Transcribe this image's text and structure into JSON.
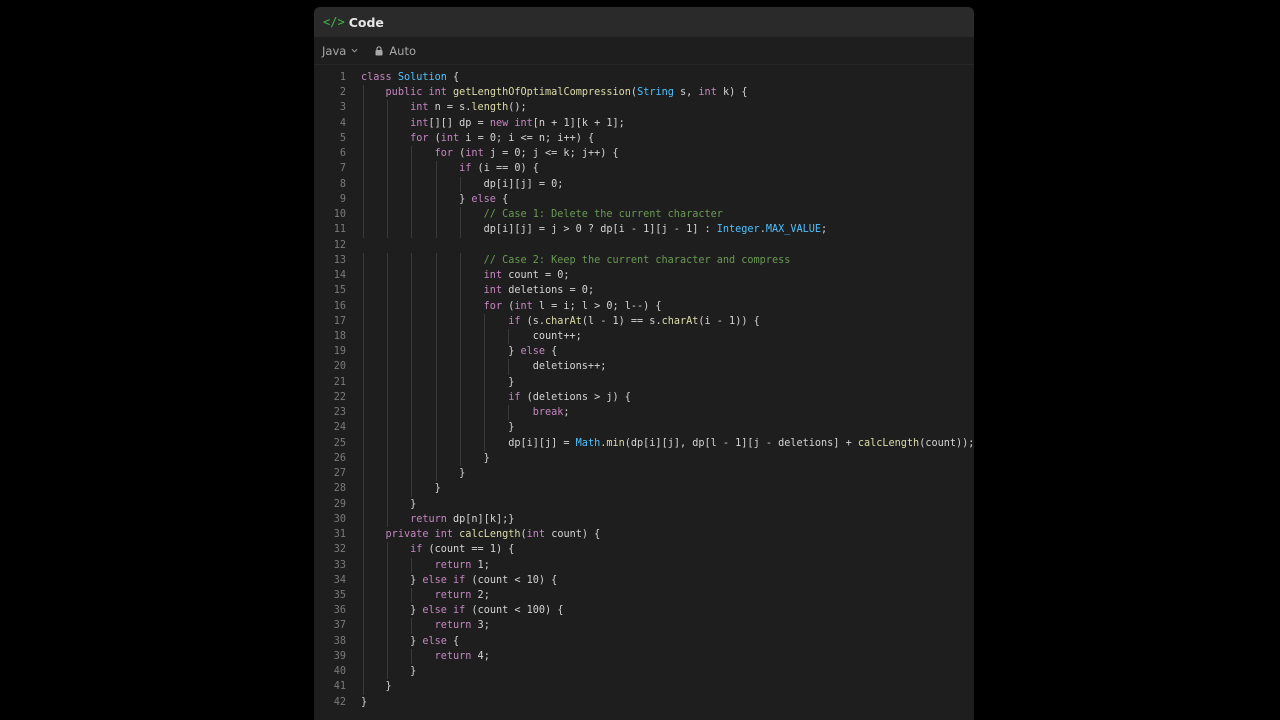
{
  "header": {
    "title": "Code",
    "icon": "code-icon"
  },
  "toolbar": {
    "language": "Java",
    "mode": "Auto"
  },
  "colors": {
    "background": "#000000",
    "panel": "#1e1e1e",
    "header": "#2a2a2a",
    "keyword": "#c586c0",
    "type": "#4fc1ff",
    "function": "#dcdcaa",
    "comment": "#6a9955",
    "text": "#d4d4d4",
    "line_number": "#7a7a7a",
    "code_icon": "#3fb950"
  },
  "code": {
    "language": "java",
    "lines": [
      "class Solution {",
      "    public int getLengthOfOptimalCompression(String s, int k) {",
      "        int n = s.length();",
      "        int[][] dp = new int[n + 1][k + 1];",
      "        for (int i = 0; i <= n; i++) {",
      "            for (int j = 0; j <= k; j++) {",
      "                if (i == 0) {",
      "                    dp[i][j] = 0;",
      "                } else {",
      "                    // Case 1: Delete the current character",
      "                    dp[i][j] = j > 0 ? dp[i - 1][j - 1] : Integer.MAX_VALUE;",
      "",
      "                    // Case 2: Keep the current character and compress",
      "                    int count = 0;",
      "                    int deletions = 0;",
      "                    for (int l = i; l > 0; l--) {",
      "                        if (s.charAt(l - 1) == s.charAt(i - 1)) {",
      "                            count++;",
      "                        } else {",
      "                            deletions++;",
      "                        }",
      "                        if (deletions > j) {",
      "                            break;",
      "                        }",
      "                        dp[i][j] = Math.min(dp[i][j], dp[l - 1][j - deletions] + calcLength(count));",
      "                    }",
      "                }",
      "            }",
      "        }",
      "        return dp[n][k];}",
      "    private int calcLength(int count) {",
      "        if (count == 1) {",
      "            return 1;",
      "        } else if (count < 10) {",
      "            return 2;",
      "        } else if (count < 100) {",
      "            return 3;",
      "        } else {",
      "            return 4;",
      "        }",
      "    }",
      "}"
    ]
  }
}
